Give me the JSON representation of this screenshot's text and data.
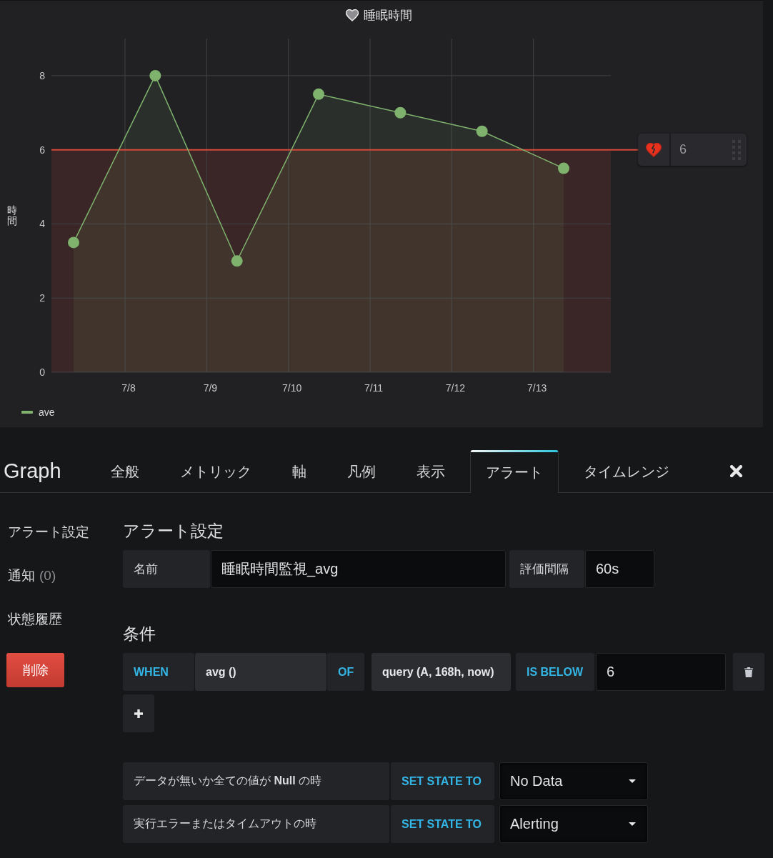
{
  "panel": {
    "chart_data": {
      "type": "area",
      "title": "睡眠時間",
      "ylabel": "時間",
      "categories": [
        null,
        "7/8",
        "7/9",
        "7/10",
        "7/11",
        "7/12",
        "7/13"
      ],
      "series": [
        {
          "name": "ave",
          "color": "#7eb26d",
          "values": [
            3.5,
            8,
            3,
            7.5,
            7,
            6.5,
            5.5
          ]
        }
      ],
      "ylim": [
        0,
        9
      ],
      "yticks": [
        0,
        2,
        4,
        6,
        8
      ],
      "grid": true,
      "ref_lines": [
        {
          "axis": "y",
          "value": 6
        }
      ],
      "bands": [
        {
          "axis": "y",
          "from": 0,
          "to": 6
        }
      ]
    },
    "threshold_handle": {
      "value": "6"
    }
  },
  "editor": {
    "title": "Graph",
    "tabs": [
      {
        "label": "全般",
        "selected": false
      },
      {
        "label": "メトリック",
        "selected": false
      },
      {
        "label": "軸",
        "selected": false
      },
      {
        "label": "凡例",
        "selected": false
      },
      {
        "label": "表示",
        "selected": false
      },
      {
        "label": "アラート",
        "selected": true
      },
      {
        "label": "タイムレンジ",
        "selected": false
      }
    ]
  },
  "sidebar": {
    "items": [
      {
        "label": "アラート設定"
      },
      {
        "label": "通知",
        "count": "(0)"
      },
      {
        "label": "状態履歴"
      }
    ],
    "delete_button": "削除"
  },
  "alert": {
    "heading": "アラート設定",
    "name": {
      "label": "名前",
      "value": "睡眠時間監視_avg"
    },
    "interval": {
      "label": "評価間隔",
      "value": "60s"
    },
    "conditions_heading": "条件",
    "conditions": [
      {
        "when": "WHEN",
        "reducer": "avg ()",
        "of": "OF",
        "query": "query (A, 168h, now)",
        "evaluator": "IS BELOW",
        "threshold": "6"
      }
    ],
    "state_rules": [
      {
        "condition": "データが無いか全ての値が **Null** の時",
        "action": "SET STATE TO",
        "state": "No Data"
      },
      {
        "condition": "実行エラーまたはタイムアウトの時",
        "action": "SET STATE TO",
        "state": "Alerting"
      }
    ]
  }
}
